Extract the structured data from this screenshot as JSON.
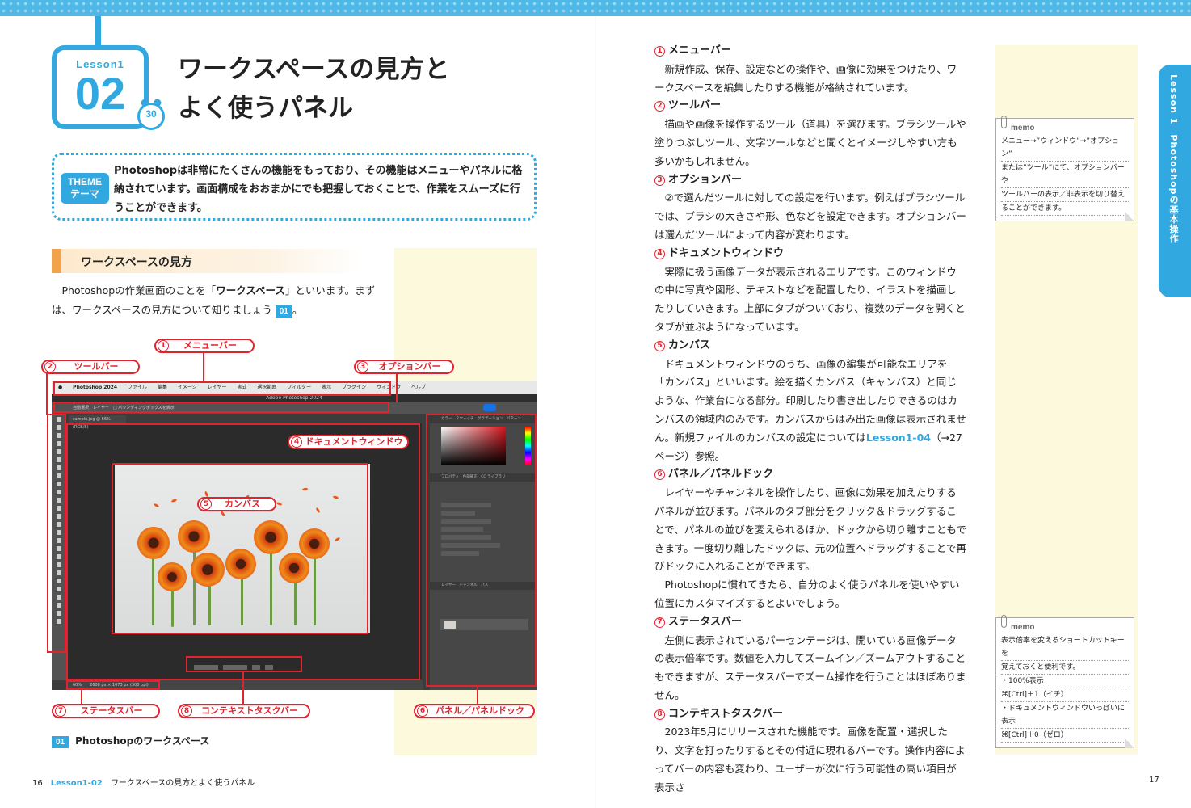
{
  "badge": {
    "lesson": "Lesson1",
    "number": "02",
    "minutes": "30"
  },
  "title": {
    "line1": "ワークスペースの見方と",
    "line2": "よく使うパネル"
  },
  "theme": {
    "label_en": "THEME",
    "label_ja": "テーマ",
    "text": "Photoshopは非常にたくさんの機能をもっており、その機能はメニューやパネルに格納されています。画面構成をおおまかにでも把握しておくことで、作業をスムーズに行うことができます。"
  },
  "section": {
    "heading": "ワークスペースの見方"
  },
  "intro": {
    "part1": "Photoshopの作業画面のことを「",
    "bold": "ワークスペース",
    "part2": "」といいます。まずは、ワークスペースの見方について知りましょう",
    "fig_ref": "01",
    "part3": "。"
  },
  "callouts": {
    "c1": {
      "num": "1",
      "label": "メニューバー"
    },
    "c2": {
      "num": "2",
      "label": "ツールバー"
    },
    "c3": {
      "num": "3",
      "label": "オプションバー"
    },
    "c4": {
      "num": "4",
      "label": "ドキュメントウィンドウ"
    },
    "c5": {
      "num": "5",
      "label": "カンバス"
    },
    "c6": {
      "num": "6",
      "label": "パネル／パネルドック"
    },
    "c7": {
      "num": "7",
      "label": "ステータスバー"
    },
    "c8": {
      "num": "8",
      "label": "コンテキストタスクバー"
    }
  },
  "screenshot": {
    "menu_items": [
      "Photoshop 2024",
      "ファイル",
      "編集",
      "イメージ",
      "レイヤー",
      "書式",
      "選択範囲",
      "フィルター",
      "表示",
      "プラグイン",
      "ウィンドウ",
      "ヘルプ"
    ],
    "window_title": "Adobe Photoshop 2024",
    "options": "自動選択：レイヤー　□ バウンディングボックスを表示",
    "doc_tab": "sample.jpg @ 66% (RGB/8)",
    "status": "60%　　2608 px × 1673 px (300 ppi)",
    "panel_tabs_1": "カラー　スウォッチ　グラデーション　パターン",
    "panel_tabs_2": "プロパティ　色調補正　CC ライブラリ",
    "panel_tabs_3": "レイヤー　チャンネル　パス"
  },
  "figure_caption": {
    "tag": "01",
    "text": "Photoshopのワークスペース"
  },
  "footer": {
    "left_page": "16",
    "left_lesson": "Lesson1-02",
    "left_title": "ワークスペースの見方とよく使うパネル",
    "right_page": "17"
  },
  "right_tab": "Lesson 1　Photoshopの基本操作",
  "sections": [
    {
      "num": "1",
      "heading": "メニューバー",
      "paras": [
        "新規作成、保存、設定などの操作や、画像に効果をつけたり、ワークスペースを編集したりする機能が格納されています。"
      ]
    },
    {
      "num": "2",
      "heading": "ツールバー",
      "paras": [
        "描画や画像を操作するツール（道具）を選びます。ブラシツールや塗りつぶしツール、文字ツールなどと聞くとイメージしやすい方も多いかもしれません。"
      ]
    },
    {
      "num": "3",
      "heading": "オプションバー",
      "paras": [
        "②で選んだツールに対しての設定を行います。例えばブラシツールでは、ブラシの大きさや形、色などを設定できます。オプションバーは選んだツールによって内容が変わります。"
      ]
    },
    {
      "num": "4",
      "heading": "ドキュメントウィンドウ",
      "paras": [
        "実際に扱う画像データが表示されるエリアです。このウィンドウの中に写真や図形、テキストなどを配置したり、イラストを描画したりしていきます。上部にタブがついており、複数のデータを開くとタブが並ぶようになっています。"
      ]
    },
    {
      "num": "5",
      "heading": "カンバス",
      "paras": [
        "ドキュメントウィンドウのうち、画像の編集が可能なエリアを「カンバス」といいます。絵を描くカンバス（キャンバス）と同じような、作業台になる部分。印刷したり書き出したりできるのはカンバスの領域内のみです。カンバスからはみ出た画像は表示されません。新規ファイルのカンバスの設定については"
      ]
    },
    {
      "num": "6",
      "heading": "パネル／パネルドック",
      "paras": [
        "レイヤーやチャンネルを操作したり、画像に効果を加えたりするパネルが並びます。パネルのタブ部分をクリック＆ドラッグすることで、パネルの並びを変えられるほか、ドックから切り離すこともできます。一度切り離したドックは、元の位置へドラッグすることで再びドックに入れることができます。",
        "Photoshopに慣れてきたら、自分のよく使うパネルを使いやすい位置にカスタマイズするとよいでしょう。"
      ]
    },
    {
      "num": "7",
      "heading": "ステータスバー",
      "paras": [
        "左側に表示されているパーセンテージは、開いている画像データの表示倍率です。数値を入力してズームイン／ズームアウトすることもできますが、ステータスバーでズーム操作を行うことはほぼありません。"
      ]
    },
    {
      "num": "8",
      "heading": "コンテキストタスクバー",
      "paras": [
        "2023年5月にリリースされた機能です。画像を配置・選択したり、文字を打ったりするとその付近に現れるバーです。操作内容によってバーの内容も変わり、ユーザーが次に行う可能性の高い項目が表示さ"
      ]
    }
  ],
  "canvas_link": {
    "ref": "Lesson1-04",
    "rest": "（→27ページ）参照。"
  },
  "memo1": {
    "head": "memo",
    "lines": [
      "メニュー→”ウィンドウ”→”オプション”",
      "または”ツール”にて、オプションバーや",
      "ツールバーの表示／非表示を切り替え",
      "ることができます。"
    ]
  },
  "memo2": {
    "head": "memo",
    "lines": [
      "表示倍率を変えるショートカットキーを",
      "覚えておくと便利です。",
      "・100%表示",
      "⌘[Ctrl]＋1（イチ）",
      "・ドキュメントウィンドウいっぱいに表示",
      "⌘[Ctrl]＋0（ゼロ）"
    ]
  },
  "colors": {
    "accent": "#31a9e0",
    "callout": "#e0242f",
    "heading_bar": "#f1a24a",
    "side_column": "#fdf9dd"
  }
}
